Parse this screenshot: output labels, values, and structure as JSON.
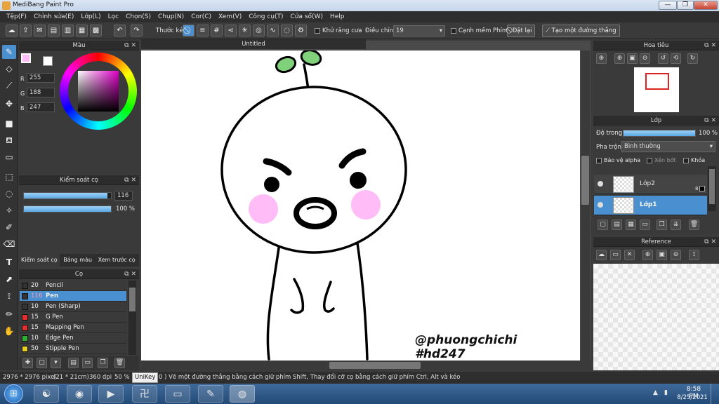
{
  "window": {
    "title": "MediBang Paint Pro",
    "controls": [
      "—",
      "❐",
      "✕"
    ]
  },
  "menu": [
    "Tệp(F)",
    "Chỉnh sửa(E)",
    "Lớp(L)",
    "Lọc",
    "Chọn(S)",
    "Chụp(N)",
    "Cor(C)",
    "Xem(V)",
    "Công cụ(T)",
    "Cửa sổ(W)",
    "Help"
  ],
  "toolbar": {
    "ruler_label": "Thước kẻ",
    "antialias_label": "Khử răng cưa",
    "correction_label": "Điều chỉnh",
    "correction_value": "19",
    "smooth_label": "Cạnh mềm",
    "key_label": "Phím",
    "reset_label": "Đặt lại",
    "make_line_label": "Tạo một đường thẳng"
  },
  "color_panel": {
    "title": "Màu",
    "r_label": "R",
    "r_value": "255",
    "g_label": "G",
    "g_value": "188",
    "b_label": "B",
    "b_value": "247",
    "primary_color": "#ffbcf7",
    "secondary_color": "#ffffff"
  },
  "brush_control": {
    "title": "Kiểm soát cọ",
    "size_value": "116",
    "size_fraction": 0.96,
    "opacity_value": "100 %",
    "opacity_fraction": 1.0,
    "tabs": [
      "Kiểm soát cọ",
      "Bảng màu",
      "Xem trước cọ"
    ]
  },
  "brush_panel": {
    "title": "Cọ",
    "items": [
      {
        "size": "20",
        "name": "Pencil",
        "color": "#333333"
      },
      {
        "size": "116",
        "name": "Pen",
        "color": "#333333",
        "selected": true
      },
      {
        "size": "10",
        "name": "Pen (Sharp)",
        "color": "#333333"
      },
      {
        "size": "15",
        "name": "G Pen",
        "color": "#e03030"
      },
      {
        "size": "15",
        "name": "Mapping Pen",
        "color": "#e03030"
      },
      {
        "size": "10",
        "name": "Edge Pen",
        "color": "#30b030"
      },
      {
        "size": "50",
        "name": "Stipple Pen",
        "color": "#e8d020"
      }
    ]
  },
  "canvas": {
    "tab_title": "Untitled",
    "signature_line1": "@phuongchichi",
    "signature_line2": "#hd247"
  },
  "navigator": {
    "title": "Hoa tiêu"
  },
  "layers": {
    "title": "Lớp",
    "opacity_label": "Độ trong",
    "opacity_value": "100 %",
    "blend_label": "Pha trộn",
    "blend_value": "Bình thường",
    "protect_alpha": "Bảo vệ alpha",
    "clipping": "Xén bớt",
    "lock": "Khóa",
    "items": [
      {
        "name": "Lớp2",
        "badge": "8",
        "selected": false
      },
      {
        "name": "Lớp1",
        "selected": true
      }
    ]
  },
  "reference": {
    "title": "Reference"
  },
  "status": {
    "dimensions": "2976 * 2976 pixel",
    "size_cm": "(21 * 21cm)",
    "dpi": "360 dpi",
    "zoom": "50 %",
    "unikey": "UniKey",
    "hint": "0 ) Vẽ một đường thẳng bằng cách giữ phím Shift, Thay đổi cỡ cọ bằng cách giữ phím Ctrl, Alt và kéo"
  },
  "taskbar": {
    "time": "8:58 PM",
    "date": "8/25/2021"
  }
}
